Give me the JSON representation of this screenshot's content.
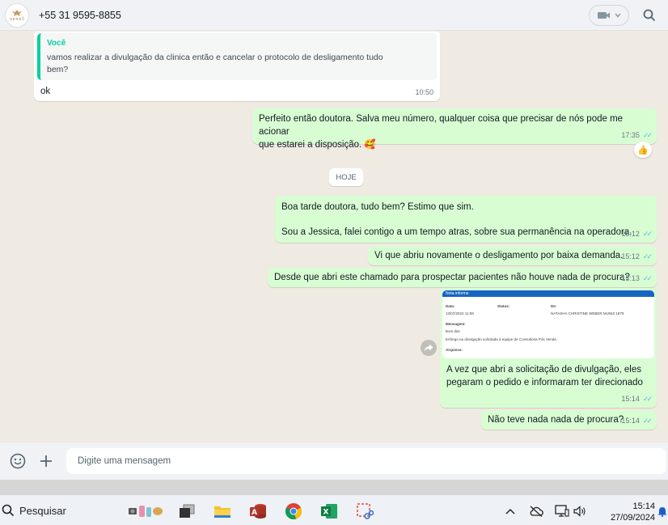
{
  "header": {
    "avatar_text": "vexel",
    "contact_name": "+55 31 9595-8855"
  },
  "messages": [
    {
      "id": "m1",
      "direction": "in",
      "quote_author": "Você",
      "quote_line1": "vamos realizar a divulgação da clinica então e cancelar o protocolo de desligamento tudo",
      "quote_line2": "bem?",
      "text": "ok",
      "time": "10:50"
    },
    {
      "id": "m2",
      "direction": "out",
      "line1": "Perfeito então doutora. Salva meu número, qualquer coisa que precisar de nós pode me acionar",
      "line2": "que estarei a disposição. 🥰",
      "time": "17:35",
      "reaction": "👍"
    },
    {
      "id": "m3",
      "direction": "out",
      "line1": "Boa tarde doutora, tudo bem? Estimo que sim.",
      "line2": "Sou a Jessica, falei contigo a um tempo atras, sobre sua permanência na operadora.",
      "time": "15:12"
    },
    {
      "id": "m4",
      "direction": "out",
      "text": "Vi que abriu novamente o desligamento por baixa demanda.",
      "time": "15:12"
    },
    {
      "id": "m5",
      "direction": "out",
      "text": "Desde que abri este chamado para prospectar pacientes não houve nada de procura?",
      "time": "15:13"
    },
    {
      "id": "m6",
      "direction": "out",
      "image": {
        "bar_title": "Nota informe",
        "data_label": "Data:",
        "data_value": "13/07/2024 11:58",
        "status_label": "Status:",
        "de_label": "De:",
        "de_value": "NATASHA CHRISTINE WEBER MUNIZ 1879",
        "mensagem_label": "Mensagem:",
        "mensagem_line1": "Bom dia!",
        "mensagem_line2": "Enfrego na divulgação solicitada à equipe de Consultoria Pós Venda.",
        "arquivos_label": "Arquivos:"
      },
      "line1": "A vez que abri a solicitação de divulgação, eles",
      "line2": "pegaram o pedido e informaram ter direcionado",
      "time": "15:14"
    },
    {
      "id": "m7",
      "direction": "out",
      "text": "Não teve nada nada de procura?",
      "time": "15:14"
    }
  ],
  "date_divider": "HOJE",
  "composer": {
    "placeholder": "Digite uma mensagem"
  },
  "taskbar": {
    "search_label": "Pesquisar",
    "time": "15:14",
    "date": "27/09/2024"
  },
  "colors": {
    "accent": "#06cf9c",
    "outgoing_bubble": "#d9fdd3",
    "incoming_bubble": "#ffffff",
    "chat_bg": "#efeae2",
    "read_ticks": "#53bdeb"
  }
}
